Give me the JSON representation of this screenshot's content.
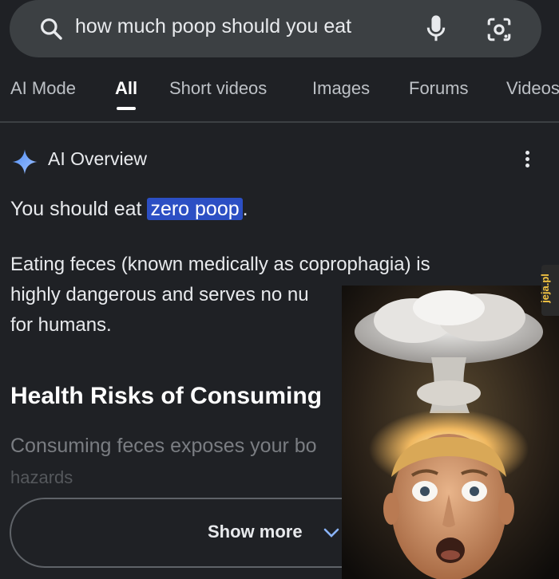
{
  "search": {
    "query": "how much poop should you eat"
  },
  "tabs": [
    {
      "label": "AI Mode",
      "active": false
    },
    {
      "label": "All",
      "active": true
    },
    {
      "label": "Short videos",
      "active": false
    },
    {
      "label": "Images",
      "active": false
    },
    {
      "label": "Forums",
      "active": false
    },
    {
      "label": "Videos",
      "active": false
    }
  ],
  "ai_overview": {
    "title": "AI Overview",
    "answer_prefix": "You should eat ",
    "answer_highlight": "zero poop",
    "answer_suffix": ".",
    "paragraph_line1": "Eating feces (known medically as coprophagia) is",
    "paragraph_line2": "highly dangerous and serves no nu",
    "paragraph_line3": "for humans.",
    "section_heading": "Health Risks of Consuming",
    "faded_line1": "Consuming feces exposes your bo",
    "faded_line2": "hazards",
    "show_more_label": "Show more"
  },
  "watermark": "jeja.pl",
  "colors": {
    "background": "#1f2125",
    "search_bar": "#3c4043",
    "highlight": "#2c4fc4",
    "sparkle_blue": "#4c8bf5"
  }
}
